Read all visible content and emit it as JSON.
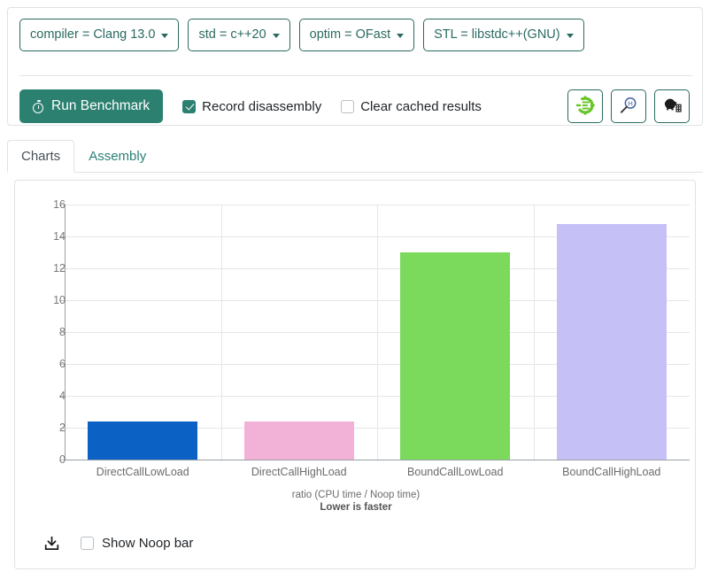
{
  "selectors": [
    {
      "label": "compiler = Clang 13.0",
      "name": "compiler-dropdown"
    },
    {
      "label": "std = c++20",
      "name": "std-dropdown"
    },
    {
      "label": "optim = OFast",
      "name": "optim-dropdown"
    },
    {
      "label": "STL = libstdc++(GNU)",
      "name": "stl-dropdown"
    }
  ],
  "actions": {
    "run_label": "Run Benchmark",
    "record_disassembly_label": "Record disassembly",
    "record_disassembly_checked": true,
    "clear_cached_label": "Clear cached results",
    "clear_cached_checked": false
  },
  "icon_buttons": [
    {
      "name": "compiler-explorer-icon",
      "title": "compiler-explorer-gear"
    },
    {
      "name": "quick-bench-icon",
      "title": "magnifier-h"
    },
    {
      "name": "build-bench-icon",
      "title": "beaver"
    }
  ],
  "tabs": [
    {
      "label": "Charts",
      "active": true
    },
    {
      "label": "Assembly",
      "active": false
    }
  ],
  "chart_footer": {
    "download_icon": "download-icon",
    "show_noop_label": "Show Noop bar",
    "show_noop_checked": false
  },
  "colors": {
    "accent_teal": "#2b8070",
    "outline_teal": "#2a6a60",
    "bar_blue": "#0b62c4",
    "bar_pink": "#f2b2d8",
    "bar_green": "#7bd95c",
    "bar_purple": "#c5c0f5",
    "grid": "#e6e6e6",
    "axis": "#9aa0a6"
  },
  "chart_data": {
    "type": "bar",
    "title": "",
    "categories": [
      "DirectCallLowLoad",
      "DirectCallHighLoad",
      "BoundCallLowLoad",
      "BoundCallHighLoad"
    ],
    "values": [
      2.4,
      2.4,
      13.0,
      14.8
    ],
    "colors": [
      "#0b62c4",
      "#f2b2d8",
      "#7bd95c",
      "#c5c0f5"
    ],
    "xlabel": "ratio (CPU time / Noop time)",
    "xlabel_sub": "Lower is faster",
    "ylabel": "",
    "ylim": [
      0,
      16
    ],
    "yticks": [
      0,
      2,
      4,
      6,
      8,
      10,
      12,
      14,
      16
    ],
    "ytick_labels": [
      "0",
      "2",
      "4",
      "6",
      "8",
      "10",
      "12",
      "14",
      "16"
    ],
    "grid": true,
    "legend": false
  }
}
